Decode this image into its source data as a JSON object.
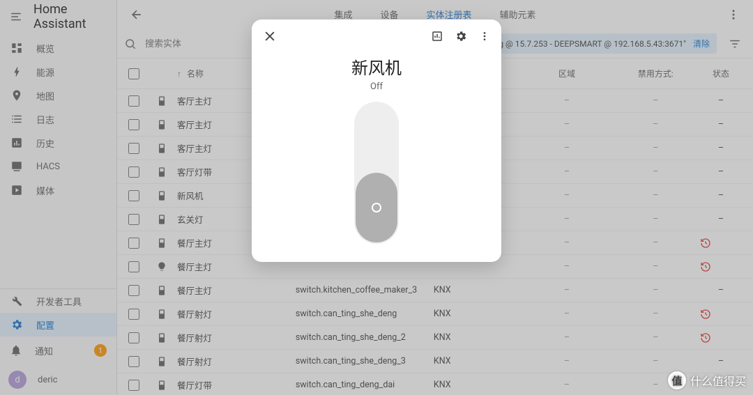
{
  "app": {
    "title": "Home Assistant"
  },
  "sidebar": {
    "items": [
      {
        "label": "概览"
      },
      {
        "label": "能源"
      },
      {
        "label": "地图"
      },
      {
        "label": "日志"
      },
      {
        "label": "历史"
      },
      {
        "label": "HACS"
      },
      {
        "label": "媒体"
      }
    ],
    "dev_label": "开发者工具",
    "config_label": "配置",
    "notify_label": "通知",
    "notify_count": "1",
    "user_initial": "d",
    "user_name": "deric"
  },
  "tabs": [
    {
      "label": "集成"
    },
    {
      "label": "设备"
    },
    {
      "label": "实体注册表"
    },
    {
      "label": "辅助元素"
    }
  ],
  "search": {
    "placeholder": "搜索实体"
  },
  "notice": {
    "text": "\"KNX: Tunneling @ 15.7.253 - DEEPSMART @ 192.168.5.43:3671\"",
    "clear": "清除"
  },
  "columns": {
    "name": "名称",
    "area": "区域",
    "disabled": "禁用方式:",
    "status": "状态"
  },
  "rows": [
    {
      "name": "客厅主灯",
      "entity": "",
      "integration": "",
      "area": "–",
      "disabled": "–",
      "status": "–",
      "icon": "switch"
    },
    {
      "name": "客厅主灯",
      "entity": "",
      "integration": "",
      "area": "–",
      "disabled": "–",
      "status": "–",
      "icon": "switch"
    },
    {
      "name": "客厅主灯",
      "entity": "",
      "integration": "",
      "area": "–",
      "disabled": "–",
      "status": "–",
      "icon": "switch"
    },
    {
      "name": "客厅灯带",
      "entity": "",
      "integration": "",
      "area": "–",
      "disabled": "–",
      "status": "–",
      "icon": "switch"
    },
    {
      "name": "新风机",
      "entity": "",
      "integration": "",
      "area": "–",
      "disabled": "–",
      "status": "–",
      "icon": "switch"
    },
    {
      "name": "玄关灯",
      "entity": "",
      "integration": "",
      "area": "–",
      "disabled": "–",
      "status": "–",
      "icon": "switch"
    },
    {
      "name": "餐厅主灯",
      "entity": "",
      "integration": "",
      "area": "–",
      "disabled": "–",
      "status": "restore",
      "icon": "switch"
    },
    {
      "name": "餐厅主灯",
      "entity": "",
      "integration": "",
      "area": "–",
      "disabled": "–",
      "status": "restore",
      "icon": "bulb"
    },
    {
      "name": "餐厅主灯",
      "entity": "switch.kitchen_coffee_maker_3",
      "integration": "KNX",
      "area": "–",
      "disabled": "–",
      "status": "–",
      "icon": "switch"
    },
    {
      "name": "餐厅射灯",
      "entity": "switch.can_ting_she_deng",
      "integration": "KNX",
      "area": "–",
      "disabled": "–",
      "status": "restore",
      "icon": "switch"
    },
    {
      "name": "餐厅射灯",
      "entity": "switch.can_ting_she_deng_2",
      "integration": "KNX",
      "area": "–",
      "disabled": "–",
      "status": "restore",
      "icon": "switch"
    },
    {
      "name": "餐厅射灯",
      "entity": "switch.can_ting_she_deng_3",
      "integration": "KNX",
      "area": "–",
      "disabled": "–",
      "status": "–",
      "icon": "switch"
    },
    {
      "name": "餐厅灯带",
      "entity": "switch.can_ting_deng_dai",
      "integration": "KNX",
      "area": "–",
      "disabled": "–",
      "status": "–",
      "icon": "switch"
    }
  ],
  "dialog": {
    "title": "新风机",
    "state": "Off"
  },
  "watermark": {
    "text": "什么值得买",
    "badge": "值"
  }
}
